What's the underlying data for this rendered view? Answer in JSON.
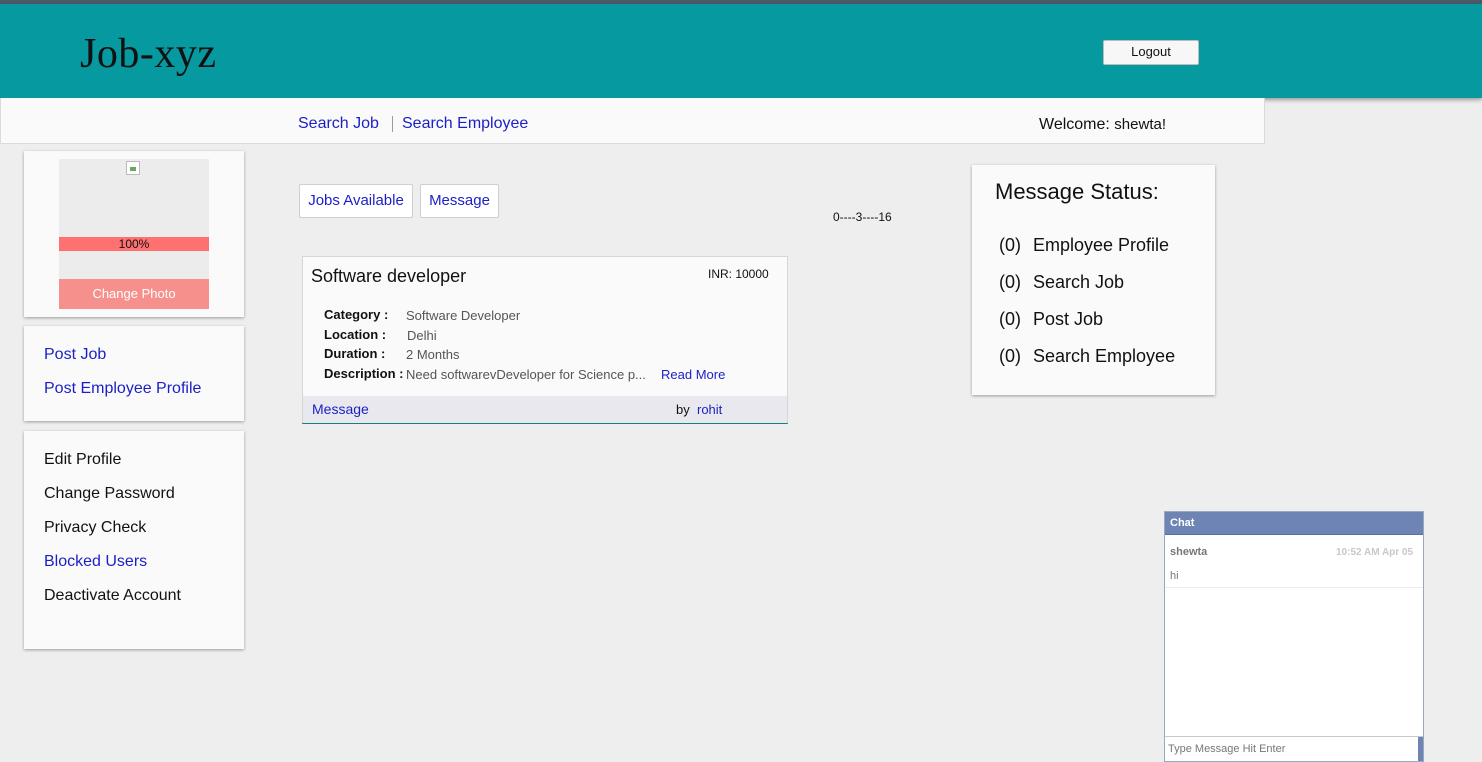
{
  "header": {
    "logo": "Job-xyz",
    "logout_label": "Logout",
    "bg_color": "#06999f"
  },
  "nav": {
    "search_job": "Search Job",
    "search_employee": "Search Employee",
    "welcome_label": "Welcome:",
    "username": "shewta!"
  },
  "profile": {
    "progress_label": "100%",
    "progress_value": 1.0,
    "change_photo": "Change Photo"
  },
  "post_menu": {
    "items": [
      "Post Job",
      "Post Employee Profile"
    ]
  },
  "account_menu": {
    "items": [
      "Edit Profile",
      "Change Password",
      "Privacy Check",
      "Blocked Users",
      "Deactivate Account"
    ]
  },
  "tabs": {
    "jobs_available": "Jobs Available",
    "message": "Message"
  },
  "pager": "0----3----16",
  "job": {
    "title": "Software developer",
    "salary": "INR: 10000",
    "category_label": "Category :",
    "category": "Software Developer",
    "location_label": "Location :",
    "location": "Delhi",
    "duration_label": "Duration :",
    "duration": "2 Months",
    "description_label": "Description :",
    "description": "Need softwarevDeveloper for Science p...",
    "read_more": "Read More",
    "message_link": "Message",
    "by_label": "by",
    "author": "rohit"
  },
  "message_status": {
    "title": "Message Status:",
    "items": [
      {
        "count": "(0)",
        "label": "Employee Profile"
      },
      {
        "count": "(0)",
        "label": "Search Job"
      },
      {
        "count": "(0)",
        "label": "Post Job"
      },
      {
        "count": "(0)",
        "label": "Search Employee"
      }
    ]
  },
  "chat": {
    "title": "Chat",
    "messages": [
      {
        "user": "shewta",
        "time": "10:52 AM Apr 05",
        "text": "hi"
      }
    ],
    "input_placeholder": "Type Message Hit Enter"
  },
  "colors": {
    "link": "#1a1fc6",
    "progress_fill": "#ff7070",
    "change_photo_bg": "#f6908c",
    "chat_header": "#6d84b4"
  }
}
